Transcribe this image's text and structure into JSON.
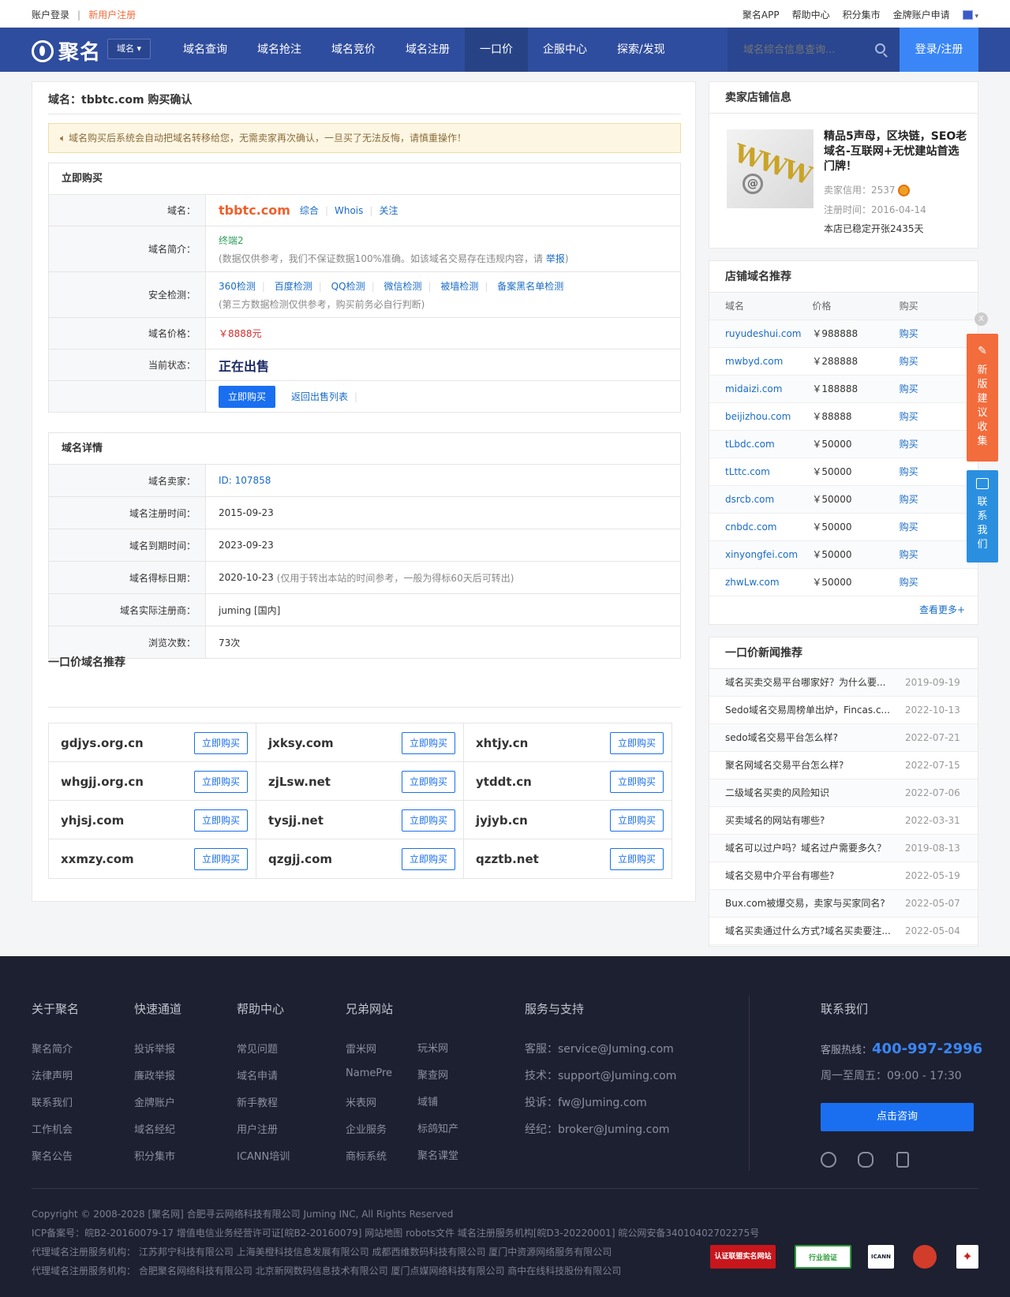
{
  "topbar": {
    "login": "账户登录",
    "sep": "|",
    "register": "新用户注册",
    "links": [
      "聚名APP",
      "帮助中心",
      "积分集市",
      "金牌账户申请"
    ]
  },
  "nav": {
    "logo_text": "聚名",
    "domain_select": "域名",
    "items": [
      "域名查询",
      "域名抢注",
      "域名竞价",
      "域名注册",
      "一口价",
      "企服中心",
      "探索/发现"
    ],
    "active": "一口价",
    "search_placeholder": "域名综合信息查询...",
    "login_register": "登录/注册"
  },
  "page": {
    "title": "域名：tbbtc.com 购买确认",
    "notice": "域名购买后系统会自动把域名转移给您，无需卖家再次确认，一旦买了无法反悔，请慎重操作！",
    "buy_section": {
      "head": "立即购买",
      "domain_label": "域名：",
      "domain": "tbbtc.com",
      "domain_links": [
        "综合",
        "Whois",
        "关注"
      ],
      "intro_label": "域名简介：",
      "intro": "终端2",
      "intro_note": "(数据仅供参考，我们不保证数据100%准确。如该域名交易存在违规内容，请",
      "report": "举报",
      "intro_note_end": ")",
      "security_label": "安全检测：",
      "security_links": [
        "360检测",
        "百度检测",
        "QQ检测",
        "微信检测",
        "被墙检测",
        "备案黑名单检测"
      ],
      "security_note": "(第三方数据检测仅供参考，购买前务必自行判断)",
      "price_label": "域名价格：",
      "price": "￥8888元",
      "status_label": "当前状态：",
      "status": "正在出售",
      "buy_button": "立即购买",
      "back_link": "返回出售列表"
    },
    "detail_section": {
      "head": "域名详情",
      "rows": [
        {
          "label": "域名卖家：",
          "value": "ID: 107858"
        },
        {
          "label": "域名注册时间：",
          "value": "2015-09-23"
        },
        {
          "label": "域名到期时间：",
          "value": "2023-09-23"
        },
        {
          "label": "域名得标日期：",
          "value": "2020-10-23",
          "note": "(仅用于转出本站的时间参考，一般为得标60天后可转出)"
        },
        {
          "label": "域名实际注册商：",
          "value": "juming [国内]"
        },
        {
          "label": "浏览次数：",
          "value": "73次"
        }
      ]
    },
    "recommend": {
      "title": "一口价域名推荐",
      "button": "立即购买",
      "domains": [
        "gdjys.org.cn",
        "jxksy.com",
        "xhtjy.cn",
        "whgjj.org.cn",
        "zjLsw.net",
        "ytddt.cn",
        "yhjsj.com",
        "tysjj.net",
        "jyjyb.cn",
        "xxmzy.com",
        "qzgjj.com",
        "qzztb.net"
      ]
    }
  },
  "seller": {
    "head": "卖家店铺信息",
    "shop_name": "精品5声母，区块链，SEO老域名-互联网+无忧建站首选门牌！",
    "credit": "卖家信用：2537",
    "reg_time": "注册时间：2016-04-14",
    "open_days": "本店已稳定开张2435天"
  },
  "shop_domains": {
    "head": "店铺域名推荐",
    "cols": [
      "域名",
      "价格",
      "购买"
    ],
    "buy": "购买",
    "rows": [
      {
        "name": "ruyudeshui.com",
        "price": "￥988888"
      },
      {
        "name": "mwbyd.com",
        "price": "￥288888"
      },
      {
        "name": "midaizi.com",
        "price": "￥188888"
      },
      {
        "name": "beijizhou.com",
        "price": "￥88888"
      },
      {
        "name": "tLbdc.com",
        "price": "￥50000"
      },
      {
        "name": "tLttc.com",
        "price": "￥50000"
      },
      {
        "name": "dsrcb.com",
        "price": "￥50000"
      },
      {
        "name": "cnbdc.com",
        "price": "￥50000"
      },
      {
        "name": "xinyongfei.com",
        "price": "￥50000"
      },
      {
        "name": "zhwLw.com",
        "price": "￥50000"
      }
    ],
    "more": "查看更多+"
  },
  "news": {
    "head": "一口价新闻推荐",
    "rows": [
      {
        "title": "域名买卖交易平台哪家好？为什么要...",
        "date": "2019-09-19"
      },
      {
        "title": "Sedo域名交易周榜单出炉，Fincas.c...",
        "date": "2022-10-13"
      },
      {
        "title": "sedo域名交易平台怎么样?",
        "date": "2022-07-21"
      },
      {
        "title": "聚名网域名交易平台怎么样?",
        "date": "2022-07-15"
      },
      {
        "title": "二级域名买卖的风险知识",
        "date": "2022-07-06"
      },
      {
        "title": "买卖域名的网站有哪些?",
        "date": "2022-03-31"
      },
      {
        "title": "域名可以过户吗？域名过户需要多久？",
        "date": "2019-08-13"
      },
      {
        "title": "域名交易中介平台有哪些?",
        "date": "2022-05-19"
      },
      {
        "title": "Bux.com被爆交易，卖家与买家同名?",
        "date": "2022-05-07"
      },
      {
        "title": "域名买卖通过什么方式?域名买卖要注...",
        "date": "2022-05-04"
      }
    ]
  },
  "float": {
    "close": "X",
    "feedback": "新版建议收集",
    "contact": "联系我们"
  },
  "footer": {
    "about": {
      "head": "关于聚名",
      "items": [
        "聚名简介",
        "法律声明",
        "联系我们",
        "工作机会",
        "聚名公告"
      ]
    },
    "quick": {
      "head": "快速通道",
      "items": [
        "投诉举报",
        "廉政举报",
        "金牌账户",
        "域名经纪",
        "积分集市"
      ]
    },
    "help": {
      "head": "帮助中心",
      "items": [
        "常见问题",
        "域名申请",
        "新手教程",
        "用户注册",
        "ICANN培训"
      ]
    },
    "sites": {
      "head": "兄弟网站",
      "col1": [
        "雷米网",
        "NamePre",
        "米表网",
        "企业服务",
        "商标系统"
      ],
      "col2": [
        "玩米网",
        "聚查网",
        "域铺",
        "标鸽知产",
        "聚名课堂"
      ]
    },
    "service": {
      "head": "服务与支持",
      "items": [
        "客服：service@Juming.com",
        "技术：support@Juming.com",
        "投诉：fw@Juming.com",
        "经纪：broker@Juming.com"
      ]
    },
    "contact": {
      "head": "联系我们",
      "hotline_label": "客服热线：",
      "hotline": "400-997-2996",
      "hours": "周一至周五：09:00 - 17:30",
      "consult": "点击咨询"
    },
    "copyright": "Copyright © 2008-2028 [聚名网] 合肥寻云网络科技有限公司 Juming INC, All Rights Reserved",
    "icp": "ICP备案号：皖B2-20160079-17    增值电信业务经营许可证[皖B2-20160079] 网站地图 robots文件 域名注册服务机构[皖D3-20220001] 皖公网安备34010402702275号",
    "agents1": "代理域名注册服务机构：  江苏邦宁科技有限公司 上海美橙科技信息发展有限公司 成都西维数码科技有限公司 厦门中资源网络服务有限公司",
    "agents2": "代理域名注册服务机构：  合肥聚名网络科技有限公司 北京新网数码信息技术有限公司 厦门点媒网络科技有限公司 商中在线科技股份有限公司",
    "badges": [
      "认证联盟实名网站",
      "行业验证",
      "ICANN",
      "",
      ""
    ]
  }
}
